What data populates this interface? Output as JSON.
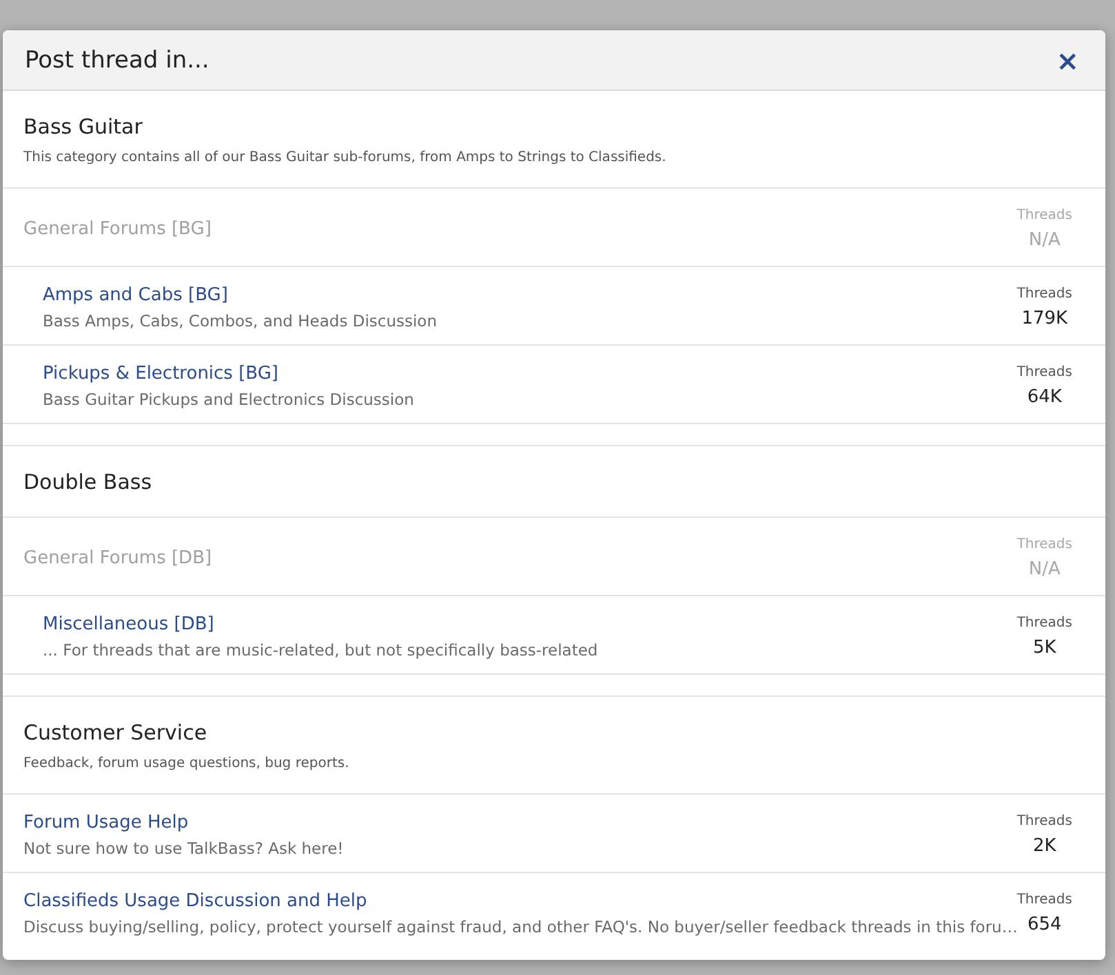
{
  "dialog": {
    "title": "Post thread in...",
    "close": "×"
  },
  "categories": [
    {
      "title": "Bass Guitar",
      "description": "This category contains all of our Bass Guitar sub-forums, from Amps to Strings to Classifieds.",
      "forums": [
        {
          "name": "General Forums [BG]",
          "disabled": true,
          "stat_label": "Threads",
          "stat": "N/A",
          "children": [
            {
              "name": "Amps and Cabs [BG]",
              "description": "Bass Amps, Cabs, Combos, and Heads Discussion",
              "disabled": false,
              "stat_label": "Threads",
              "stat": "179K"
            },
            {
              "name": "Pickups & Electronics [BG]",
              "description": "Bass Guitar Pickups and Electronics Discussion",
              "disabled": false,
              "stat_label": "Threads",
              "stat": "64K"
            }
          ]
        }
      ]
    },
    {
      "title": "Double Bass",
      "forums": [
        {
          "name": "General Forums [DB]",
          "disabled": true,
          "stat_label": "Threads",
          "stat": "N/A",
          "children": [
            {
              "name": "Miscellaneous [DB]",
              "description": "... For threads that are music-related, but not specifically bass-related",
              "disabled": false,
              "stat_label": "Threads",
              "stat": "5K"
            }
          ]
        }
      ]
    },
    {
      "title": "Customer Service",
      "description": "Feedback, forum usage questions, bug reports.",
      "forums": [
        {
          "name": "Forum Usage Help",
          "description": "Not sure how to use TalkBass? Ask here!",
          "disabled": false,
          "stat_label": "Threads",
          "stat": "2K"
        },
        {
          "name": "Classifieds Usage Discussion and Help",
          "description": "Discuss buying/selling, policy, protect yourself against fraud, and other FAQ's. No buyer/seller feedback threads in this foru…",
          "disabled": false,
          "stat_label": "Threads",
          "stat": "654"
        }
      ]
    }
  ]
}
